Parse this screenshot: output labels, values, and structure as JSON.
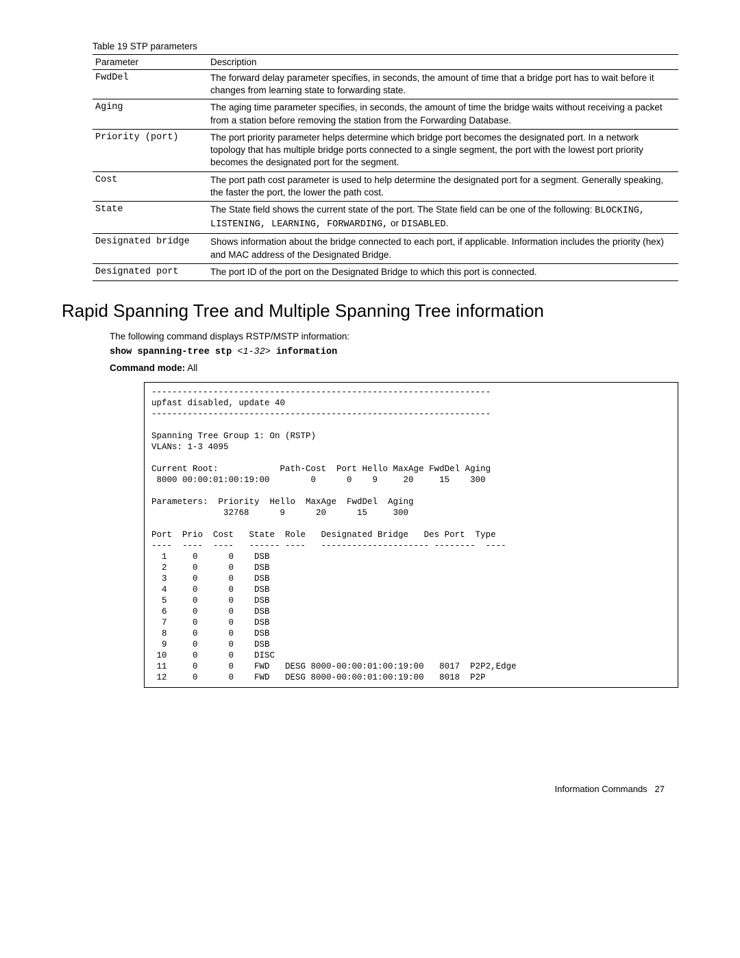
{
  "table": {
    "caption": "Table 19  STP parameters",
    "headers": {
      "param": "Parameter",
      "desc": "Description"
    },
    "rows": [
      {
        "param": "FwdDel",
        "desc": "The forward delay parameter specifies, in seconds, the amount of time that a bridge port has to wait before it changes from learning state to forwarding state."
      },
      {
        "param": "Aging",
        "desc": "The aging time parameter specifies, in seconds, the amount of time the bridge waits without receiving a packet from a station before removing the station from the Forwarding Database."
      },
      {
        "param": "Priority (port)",
        "desc": "The port priority parameter helps determine which bridge port becomes the designated port. In a network topology that has multiple bridge ports connected to a single segment, the port with the lowest port priority becomes the designated port for the segment."
      },
      {
        "param": "Cost",
        "desc": "The port path cost parameter is used to help determine the designated port for a segment. Generally speaking, the faster the port, the lower the path cost."
      },
      {
        "param": "State",
        "desc_pre": "The State field shows the current state of the port. The State field can be one of the following: ",
        "desc_mono": "BLOCKING, LISTENING, LEARNING, FORWARDING,",
        "desc_post": " or ",
        "desc_mono2": "DISABLED",
        "desc_post2": "."
      },
      {
        "param": "Designated bridge",
        "desc": "Shows information about the bridge connected to each port, if applicable. Information includes the priority (hex) and MAC address of the Designated Bridge."
      },
      {
        "param": "Designated port",
        "desc": "The port ID of the port on the Designated Bridge to which this port is connected."
      }
    ]
  },
  "section": {
    "heading": "Rapid Spanning Tree and Multiple Spanning Tree information",
    "intro": "The following command displays RSTP/MSTP information:",
    "command_pre": "show spanning-tree stp ",
    "command_arg": "<1-32>",
    "command_post": " information",
    "mode_label": "Command mode:",
    "mode_value": " All"
  },
  "output": "------------------------------------------------------------------\nupfast disabled, update 40\n------------------------------------------------------------------\n\nSpanning Tree Group 1: On (RSTP)\nVLANs: 1-3 4095\n\nCurrent Root:            Path-Cost  Port Hello MaxAge FwdDel Aging\n 8000 00:00:01:00:19:00        0      0    9     20     15    300\n\nParameters:  Priority  Hello  MaxAge  FwdDel  Aging\n              32768      9      20      15     300\n\nPort  Prio  Cost   State  Role   Designated Bridge   Des Port  Type\n----  ----  ----   ------ ----   --------------------- --------  ----\n  1     0      0    DSB\n  2     0      0    DSB\n  3     0      0    DSB\n  4     0      0    DSB\n  5     0      0    DSB\n  6     0      0    DSB\n  7     0      0    DSB\n  8     0      0    DSB\n  9     0      0    DSB\n 10     0      0    DISC\n 11     0      0    FWD   DESG 8000-00:00:01:00:19:00   8017  P2P2,Edge\n 12     0      0    FWD   DESG 8000-00:00:01:00:19:00   8018  P2P",
  "footer": {
    "label": "Information Commands",
    "page": "27"
  },
  "chart_data": {
    "type": "table",
    "title": "Spanning Tree Group 1 Port Table",
    "mode": "RSTP",
    "vlans": "1-3 4095",
    "upfast": "disabled",
    "update": 40,
    "current_root": {
      "id": "8000 00:00:01:00:19:00",
      "path_cost": 0,
      "port": 0,
      "hello": 9,
      "max_age": 20,
      "fwd_del": 15,
      "aging": 300
    },
    "parameters": {
      "priority": 32768,
      "hello": 9,
      "max_age": 20,
      "fwd_del": 15,
      "aging": 300
    },
    "columns": [
      "Port",
      "Prio",
      "Cost",
      "State",
      "Role",
      "Designated Bridge",
      "Des Port",
      "Type"
    ],
    "rows": [
      {
        "port": 1,
        "prio": 0,
        "cost": 0,
        "state": "DSB"
      },
      {
        "port": 2,
        "prio": 0,
        "cost": 0,
        "state": "DSB"
      },
      {
        "port": 3,
        "prio": 0,
        "cost": 0,
        "state": "DSB"
      },
      {
        "port": 4,
        "prio": 0,
        "cost": 0,
        "state": "DSB"
      },
      {
        "port": 5,
        "prio": 0,
        "cost": 0,
        "state": "DSB"
      },
      {
        "port": 6,
        "prio": 0,
        "cost": 0,
        "state": "DSB"
      },
      {
        "port": 7,
        "prio": 0,
        "cost": 0,
        "state": "DSB"
      },
      {
        "port": 8,
        "prio": 0,
        "cost": 0,
        "state": "DSB"
      },
      {
        "port": 9,
        "prio": 0,
        "cost": 0,
        "state": "DSB"
      },
      {
        "port": 10,
        "prio": 0,
        "cost": 0,
        "state": "DISC"
      },
      {
        "port": 11,
        "prio": 0,
        "cost": 0,
        "state": "FWD",
        "role": "DESG",
        "designated_bridge": "8000-00:00:01:00:19:00",
        "des_port": "8017",
        "type": "P2P2,Edge"
      },
      {
        "port": 12,
        "prio": 0,
        "cost": 0,
        "state": "FWD",
        "role": "DESG",
        "designated_bridge": "8000-00:00:01:00:19:00",
        "des_port": "8018",
        "type": "P2P"
      }
    ]
  }
}
